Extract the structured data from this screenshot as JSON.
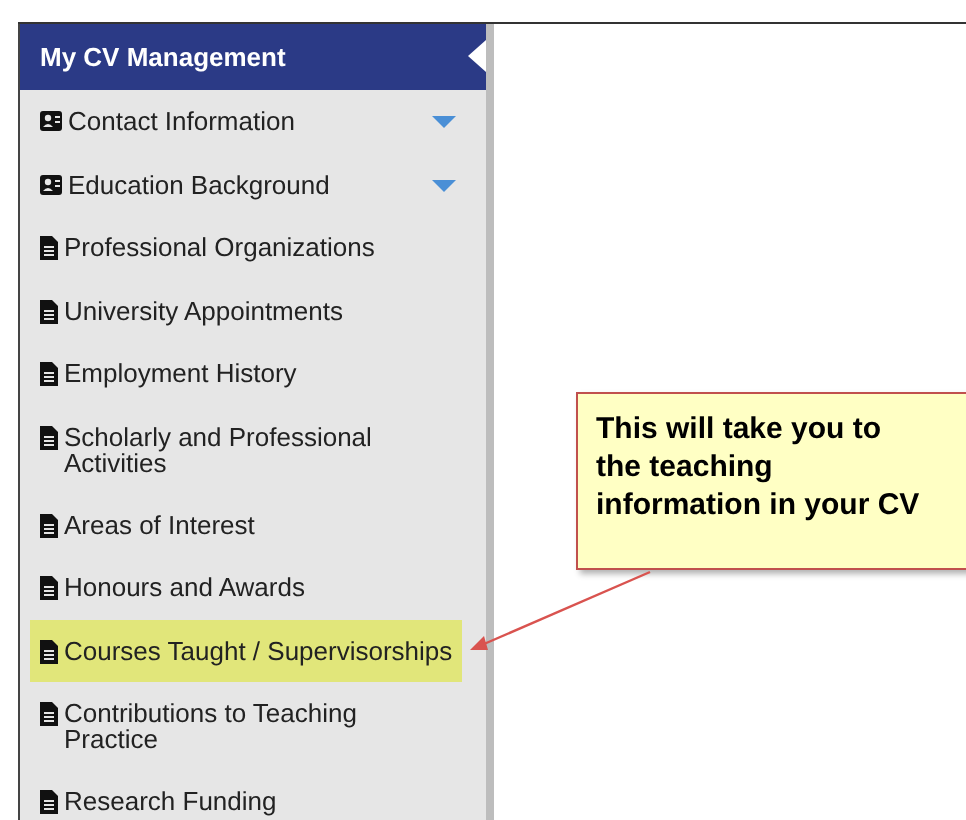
{
  "sidebar": {
    "title": "My CV Management",
    "items": [
      {
        "kind": "section",
        "label": "Contact Information",
        "highlighted": false
      },
      {
        "kind": "section",
        "label": "Education Background",
        "highlighted": false
      },
      {
        "kind": "page",
        "label": "Professional Organizations",
        "highlighted": false
      },
      {
        "kind": "page",
        "label": "University Appointments",
        "highlighted": false
      },
      {
        "kind": "page",
        "label": "Employment History",
        "highlighted": false
      },
      {
        "kind": "page",
        "label": "Scholarly and Professional Activities",
        "highlighted": false
      },
      {
        "kind": "page",
        "label": "Areas of Interest",
        "highlighted": false
      },
      {
        "kind": "page",
        "label": "Honours and Awards",
        "highlighted": false
      },
      {
        "kind": "page",
        "label": "Courses Taught / Supervisorships",
        "highlighted": true
      },
      {
        "kind": "page",
        "label": "Contributions to Teaching Practice",
        "highlighted": false
      },
      {
        "kind": "page",
        "label": "Research Funding",
        "highlighted": false
      }
    ]
  },
  "callout": {
    "lines": [
      "This will take you to",
      "the teaching",
      "information in your CV"
    ]
  }
}
